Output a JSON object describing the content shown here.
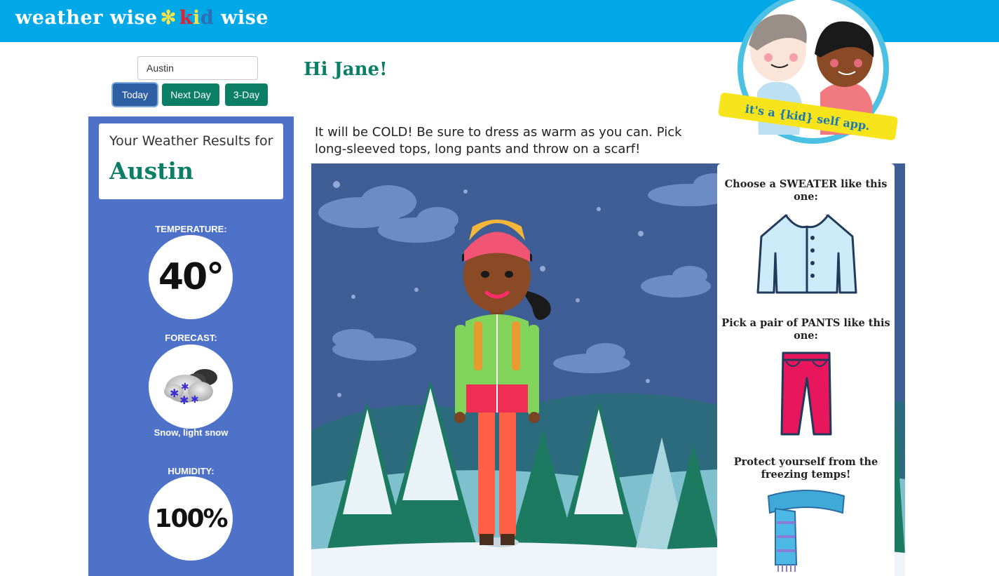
{
  "brand": {
    "part1": "weather wise",
    "star": "✻",
    "k1": "k",
    "k2": "i",
    "k3": "d",
    "part2": "wise"
  },
  "search": {
    "value": "Austin"
  },
  "nav": {
    "today": "Today",
    "next_day": "Next Day",
    "three_day": "3-Day"
  },
  "results": {
    "label": "Your Weather Results for",
    "city": "Austin"
  },
  "stats": {
    "temperature_label": "TEMPERATURE:",
    "temperature_value": "40°",
    "forecast_label": "FORECAST:",
    "forecast_desc": "Snow, light snow",
    "humidity_label": "HUMIDITY:",
    "humidity_value": "100%"
  },
  "greeting": "Hi Jane!",
  "advice": "It will be COLD! Be sure to dress as warm as you can. Pick long-sleeved tops, long pants and throw on a scarf!",
  "tips": {
    "sweater": "Choose a SWEATER like this one:",
    "pants": "Pick a pair of PANTS like this one:",
    "scarf": "Protect yourself from the freezing temps!"
  },
  "badge": "it's a {kid} self app.",
  "colors": {
    "topbar": "#00a8e8",
    "panel": "#4f72c9",
    "accent_green": "#0a7f66",
    "today_button": "#2e5fa5"
  },
  "icons": [
    "snow-cloud-icon",
    "sweater-icon",
    "pants-icon",
    "scarf-icon"
  ]
}
